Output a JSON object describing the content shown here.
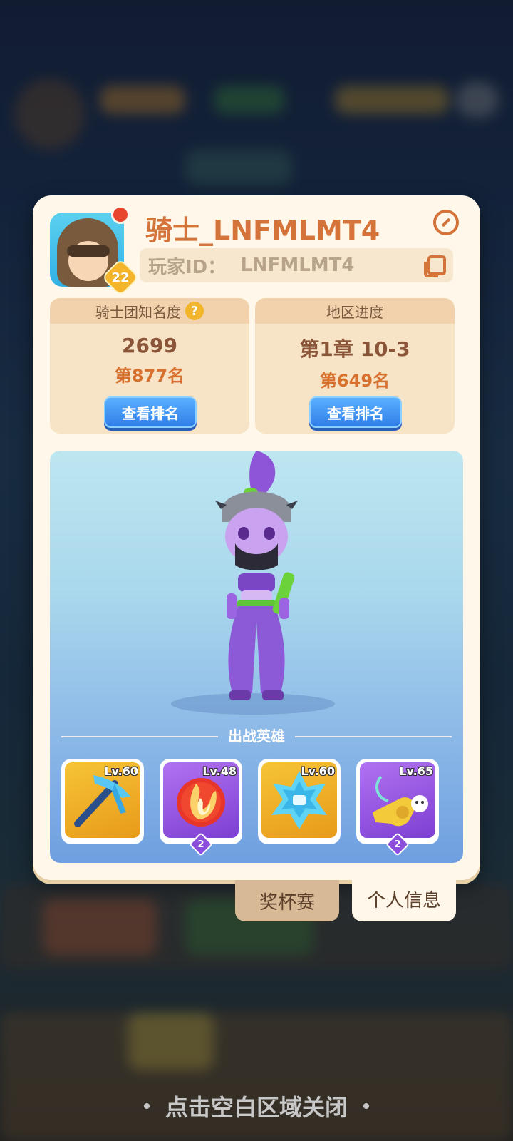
{
  "player": {
    "name": "骑士_LNFMLMT4",
    "level": "22",
    "id_label": "玩家ID：",
    "id_value": "LNFMLMT4"
  },
  "stats": [
    {
      "title": "骑士团知名度",
      "value": "2699",
      "rank": "第877名",
      "button": "查看排名"
    },
    {
      "title": "地区进度",
      "value": "第1章 10-3",
      "rank": "第649名",
      "button": "查看排名"
    }
  ],
  "heroes_section": {
    "title": "出战英雄",
    "slots": [
      {
        "level": "Lv.60",
        "icon": "ice-pickaxe-icon"
      },
      {
        "level": "Lv.48",
        "icon": "fire-orb-icon",
        "stars": "2"
      },
      {
        "level": "Lv.60",
        "icon": "ice-crystal-icon"
      },
      {
        "level": "Lv.65",
        "icon": "golden-whistle-icon",
        "stars": "2"
      }
    ]
  },
  "tabs": {
    "trophy": "奖杯赛",
    "info": "个人信息"
  },
  "close_hint": "点击空白区域关闭",
  "help_icon": "?",
  "colors": {
    "accent": "#d4743a",
    "panel": "#fff8ea",
    "button_blue": "#2f7ee8"
  }
}
